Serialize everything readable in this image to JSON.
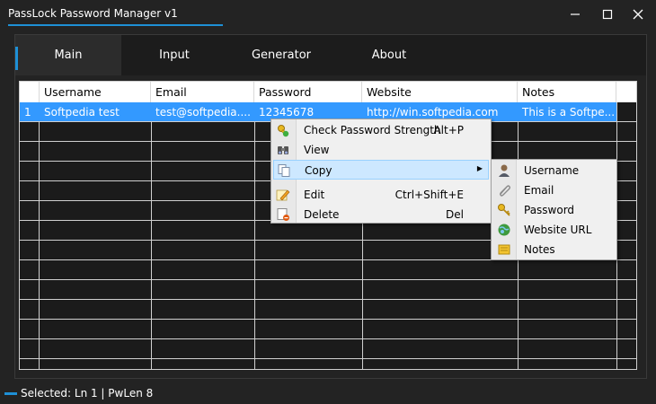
{
  "window": {
    "title": "PassLock Password Manager v1",
    "accent_color": "#1e90d6"
  },
  "tabs": [
    {
      "label": "Main",
      "active": true
    },
    {
      "label": "Input",
      "active": false
    },
    {
      "label": "Generator",
      "active": false
    },
    {
      "label": "About",
      "active": false
    }
  ],
  "grid": {
    "columns": [
      "Username",
      "Email",
      "Password",
      "Website",
      "Notes"
    ],
    "rows": [
      {
        "index": "1",
        "username": "Softpedia test",
        "email": "test@softpedia....",
        "password": "12345678",
        "website": "http://win.softpedia.com",
        "notes": "This is a Softpe..."
      }
    ],
    "selection_color": "#3399ff"
  },
  "context_menu": {
    "items": [
      {
        "label": "Check Password Strength",
        "shortcut": "Alt+P",
        "icon": "key-check-icon"
      },
      {
        "label": "View",
        "shortcut": "",
        "icon": "binoculars-icon"
      },
      {
        "label": "Copy",
        "shortcut": "",
        "icon": "copy-icon",
        "has_submenu": true
      },
      {
        "label": "Edit",
        "shortcut": "Ctrl+Shift+E",
        "icon": "pencil-icon"
      },
      {
        "label": "Delete",
        "shortcut": "Del",
        "icon": "delete-icon"
      }
    ],
    "submenu": [
      {
        "label": "Username",
        "icon": "user-icon"
      },
      {
        "label": "Email",
        "icon": "paperclip-icon"
      },
      {
        "label": "Password",
        "icon": "key-icon"
      },
      {
        "label": "Website URL",
        "icon": "globe-icon"
      },
      {
        "label": "Notes",
        "icon": "notes-icon"
      }
    ]
  },
  "status": {
    "text": "Selected: Ln 1 | PwLen 8"
  }
}
